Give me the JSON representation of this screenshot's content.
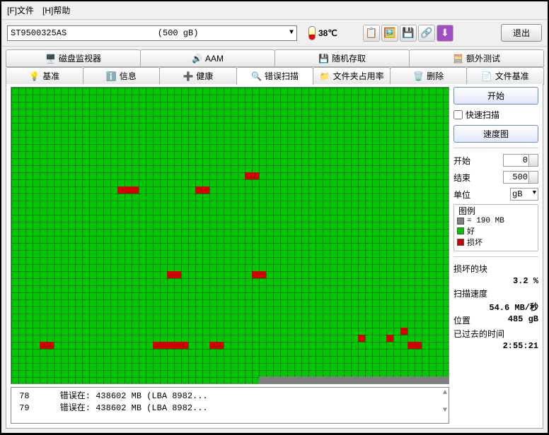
{
  "menu": {
    "file": "[F]文件",
    "help": "[H]帮助"
  },
  "toolbar": {
    "drive_model": "ST9500325AS",
    "drive_size": "(500 gB)",
    "temp": "38℃",
    "exit": "退出"
  },
  "tabs_top": [
    {
      "icon": "🖥️",
      "label": "磁盘监视器"
    },
    {
      "icon": "🔊",
      "label": "AAM"
    },
    {
      "icon": "💾",
      "label": "随机存取"
    },
    {
      "icon": "🧮",
      "label": "额外测试"
    }
  ],
  "tabs_bottom": [
    {
      "icon": "💡",
      "label": "基准"
    },
    {
      "icon": "ℹ️",
      "label": "信息"
    },
    {
      "icon": "➕",
      "label": "健康"
    },
    {
      "icon": "🔍",
      "label": "错误扫描",
      "active": true
    },
    {
      "icon": "📁",
      "label": "文件夹占用率"
    },
    {
      "icon": "🗑️",
      "label": "删除"
    },
    {
      "icon": "📄",
      "label": "文件基准"
    }
  ],
  "controls": {
    "start": "开始",
    "quick_scan": "快速扫描",
    "speed_map": "速度图",
    "start_label": "开始",
    "start_val": "0",
    "end_label": "结束",
    "end_val": "500",
    "unit_label": "单位",
    "unit_val": "gB"
  },
  "legend": {
    "title": "图例",
    "block_size": "= 190 MB",
    "good": "好",
    "bad": "损坏"
  },
  "stats": {
    "damaged_label": "损坏的块",
    "damaged_val": "3.2 %",
    "speed_label": "扫描速度",
    "speed_val": "54.6 MB/秒",
    "position_label": "位置",
    "position_val": "485 gB",
    "elapsed_label": "已过去的时间",
    "elapsed_val": "2:55:21"
  },
  "log": [
    {
      "n": "78",
      "text": "错误在:  438602 MB (LBA 8982..."
    },
    {
      "n": "79",
      "text": "错误在:  438602 MB (LBA 8982..."
    }
  ],
  "bad_blocks": [
    {
      "r": 12,
      "c": 33
    },
    {
      "r": 12,
      "c": 34
    },
    {
      "r": 14,
      "c": 15
    },
    {
      "r": 14,
      "c": 16
    },
    {
      "r": 14,
      "c": 17
    },
    {
      "r": 14,
      "c": 26
    },
    {
      "r": 14,
      "c": 27
    },
    {
      "r": 26,
      "c": 22
    },
    {
      "r": 26,
      "c": 23
    },
    {
      "r": 26,
      "c": 34
    },
    {
      "r": 26,
      "c": 35
    },
    {
      "r": 35,
      "c": 49
    },
    {
      "r": 35,
      "c": 53
    },
    {
      "r": 34,
      "c": 55
    },
    {
      "r": 36,
      "c": 4
    },
    {
      "r": 36,
      "c": 5
    },
    {
      "r": 36,
      "c": 20
    },
    {
      "r": 36,
      "c": 21
    },
    {
      "r": 36,
      "c": 22
    },
    {
      "r": 36,
      "c": 23
    },
    {
      "r": 36,
      "c": 24
    },
    {
      "r": 36,
      "c": 28
    },
    {
      "r": 36,
      "c": 29
    },
    {
      "r": 36,
      "c": 56
    },
    {
      "r": 36,
      "c": 57
    }
  ],
  "gray_start_col": 35,
  "grid_cols": 62,
  "grid_rows": 38
}
